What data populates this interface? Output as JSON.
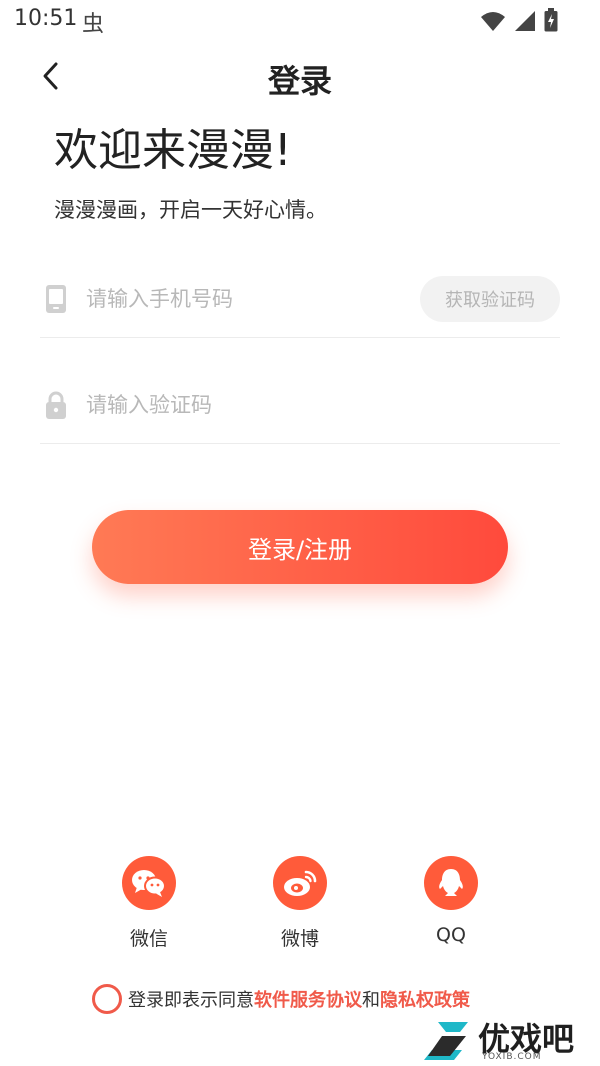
{
  "status_bar": {
    "time": "10:51"
  },
  "header": {
    "title": "登录"
  },
  "welcome": {
    "title": "欢迎来漫漫!",
    "subtitle": "漫漫漫画，开启一天好心情。"
  },
  "form": {
    "phone_placeholder": "请输入手机号码",
    "code_placeholder": "请输入验证码",
    "get_code_label": "获取验证码",
    "submit_label": "登录/注册"
  },
  "social": {
    "items": [
      {
        "label": "微信",
        "icon": "wechat-icon"
      },
      {
        "label": "微博",
        "icon": "weibo-icon"
      },
      {
        "label": "QQ",
        "icon": "qq-icon"
      }
    ]
  },
  "agreement": {
    "prefix": "登录即表示同意",
    "terms_link": "软件服务协议",
    "conjunction": "和",
    "privacy_link": "隐私权政策"
  },
  "watermark": {
    "text": "优戏吧",
    "sub": "YOXIB.COM"
  },
  "colors": {
    "accent": "#ff5b3a",
    "link": "#f05a4a",
    "disabled_bg": "#f2f2f2"
  }
}
